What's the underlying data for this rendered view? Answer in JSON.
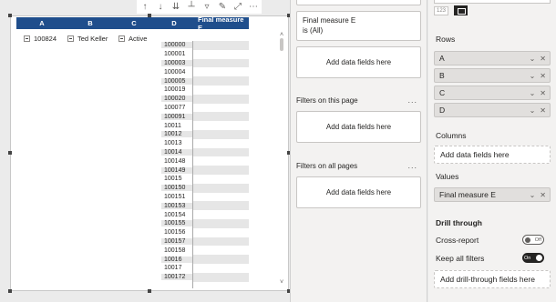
{
  "matrix": {
    "headers": [
      "A",
      "B",
      "C",
      "D",
      "Final measure E"
    ],
    "row1": {
      "a": "100824",
      "b": "Ted Keller",
      "c": "Active"
    },
    "d_values": [
      "100000",
      "100001",
      "100003",
      "100004",
      "100005",
      "100019",
      "100020",
      "100077",
      "100091",
      "10011",
      "10012",
      "10013",
      "10014",
      "100148",
      "100149",
      "10015",
      "100150",
      "100151",
      "100153",
      "100154",
      "100155",
      "100156",
      "100157",
      "100158",
      "10016",
      "10017",
      "100172"
    ]
  },
  "toolbar": {
    "icons": [
      "arrow-up-icon",
      "arrow-down-icon",
      "double-arrow-down-icon",
      "expand-hierarchy-icon",
      "filter-icon",
      "format-painter-icon",
      "focus-mode-icon",
      "more-options-icon"
    ]
  },
  "filters": {
    "measure_card": {
      "line1": "Final measure E",
      "line2": "is (All)"
    },
    "drop_text": "Add data fields here",
    "on_this_page": "Filters on this page",
    "on_all_pages": "Filters on all pages",
    "more": "..."
  },
  "build": {
    "viz_label": "123",
    "rows_label": "Rows",
    "row_fields": [
      "A",
      "B",
      "C",
      "D"
    ],
    "columns_label": "Columns",
    "columns_drop": "Add data fields here",
    "values_label": "Values",
    "value_fields": [
      "Final measure E"
    ],
    "drill_through": "Drill through",
    "cross_report": "Cross-report",
    "cross_report_state": "Off",
    "keep_all_filters": "Keep all filters",
    "keep_all_state": "On",
    "drill_drop": "Add drill-through fields here"
  },
  "colors": {
    "header_bg": "#1f4e8c",
    "band": "#e6e6e6"
  }
}
